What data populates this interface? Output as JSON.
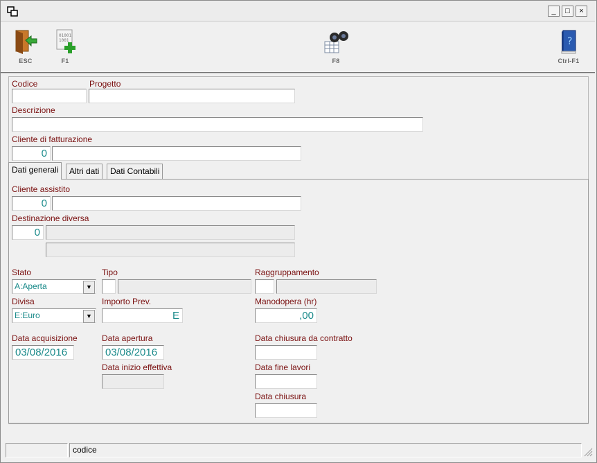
{
  "window": {
    "title": "",
    "controls": {
      "minimize": "_",
      "maximize": "□",
      "close": "×"
    }
  },
  "toolbar": {
    "esc_label": "ESC",
    "f1_label": "F1",
    "f8_label": "F8",
    "ctrl_f1_label": "Ctrl-F1",
    "icons": {
      "esc": "exit-door-icon",
      "f1": "new-record-icon",
      "f8": "search-binoculars-icon",
      "ctrl_f1": "help-book-icon"
    }
  },
  "form": {
    "codice": {
      "label": "Codice",
      "value": ""
    },
    "progetto": {
      "label": "Progetto",
      "value": ""
    },
    "descrizione": {
      "label": "Descrizione",
      "value": ""
    },
    "cliente_fatturazione": {
      "label": "Cliente di fatturazione",
      "code": "0",
      "name": ""
    }
  },
  "tabs": [
    {
      "label": "Dati generali",
      "active": true
    },
    {
      "label": "Altri dati",
      "active": false
    },
    {
      "label": "Dati Contabili",
      "active": false
    }
  ],
  "dati_generali": {
    "cliente_assistito": {
      "label": "Cliente assistito",
      "code": "0",
      "name": ""
    },
    "destinazione": {
      "label": "Destinazione diversa",
      "code": "0",
      "line1": "",
      "line2": ""
    },
    "stato": {
      "label": "Stato",
      "value": "A:Aperta"
    },
    "tipo": {
      "label": "Tipo",
      "code": "",
      "desc": ""
    },
    "raggruppamento": {
      "label": "Raggruppamento",
      "code": "",
      "desc": ""
    },
    "divisa": {
      "label": "Divisa",
      "value": "E:Euro"
    },
    "importo_prev": {
      "label": "Importo Prev.",
      "value": "E"
    },
    "manodopera": {
      "label": "Manodopera (hr)",
      "value": ",00"
    },
    "data_acquisizione": {
      "label": "Data acquisizione",
      "value": "03/08/2016"
    },
    "data_apertura": {
      "label": "Data apertura",
      "value": "03/08/2016"
    },
    "data_inizio": {
      "label": "Data inizio effettiva",
      "value": ""
    },
    "data_chiusura_contratto": {
      "label": "Data chiusura da contratto",
      "value": ""
    },
    "data_fine_lavori": {
      "label": "Data fine lavori",
      "value": ""
    },
    "data_chiusura": {
      "label": "Data chiusura",
      "value": ""
    }
  },
  "statusbar": {
    "left": "",
    "field_hint": "codice"
  },
  "colors": {
    "label": "#7a1010",
    "value": "#1a8a8a"
  }
}
